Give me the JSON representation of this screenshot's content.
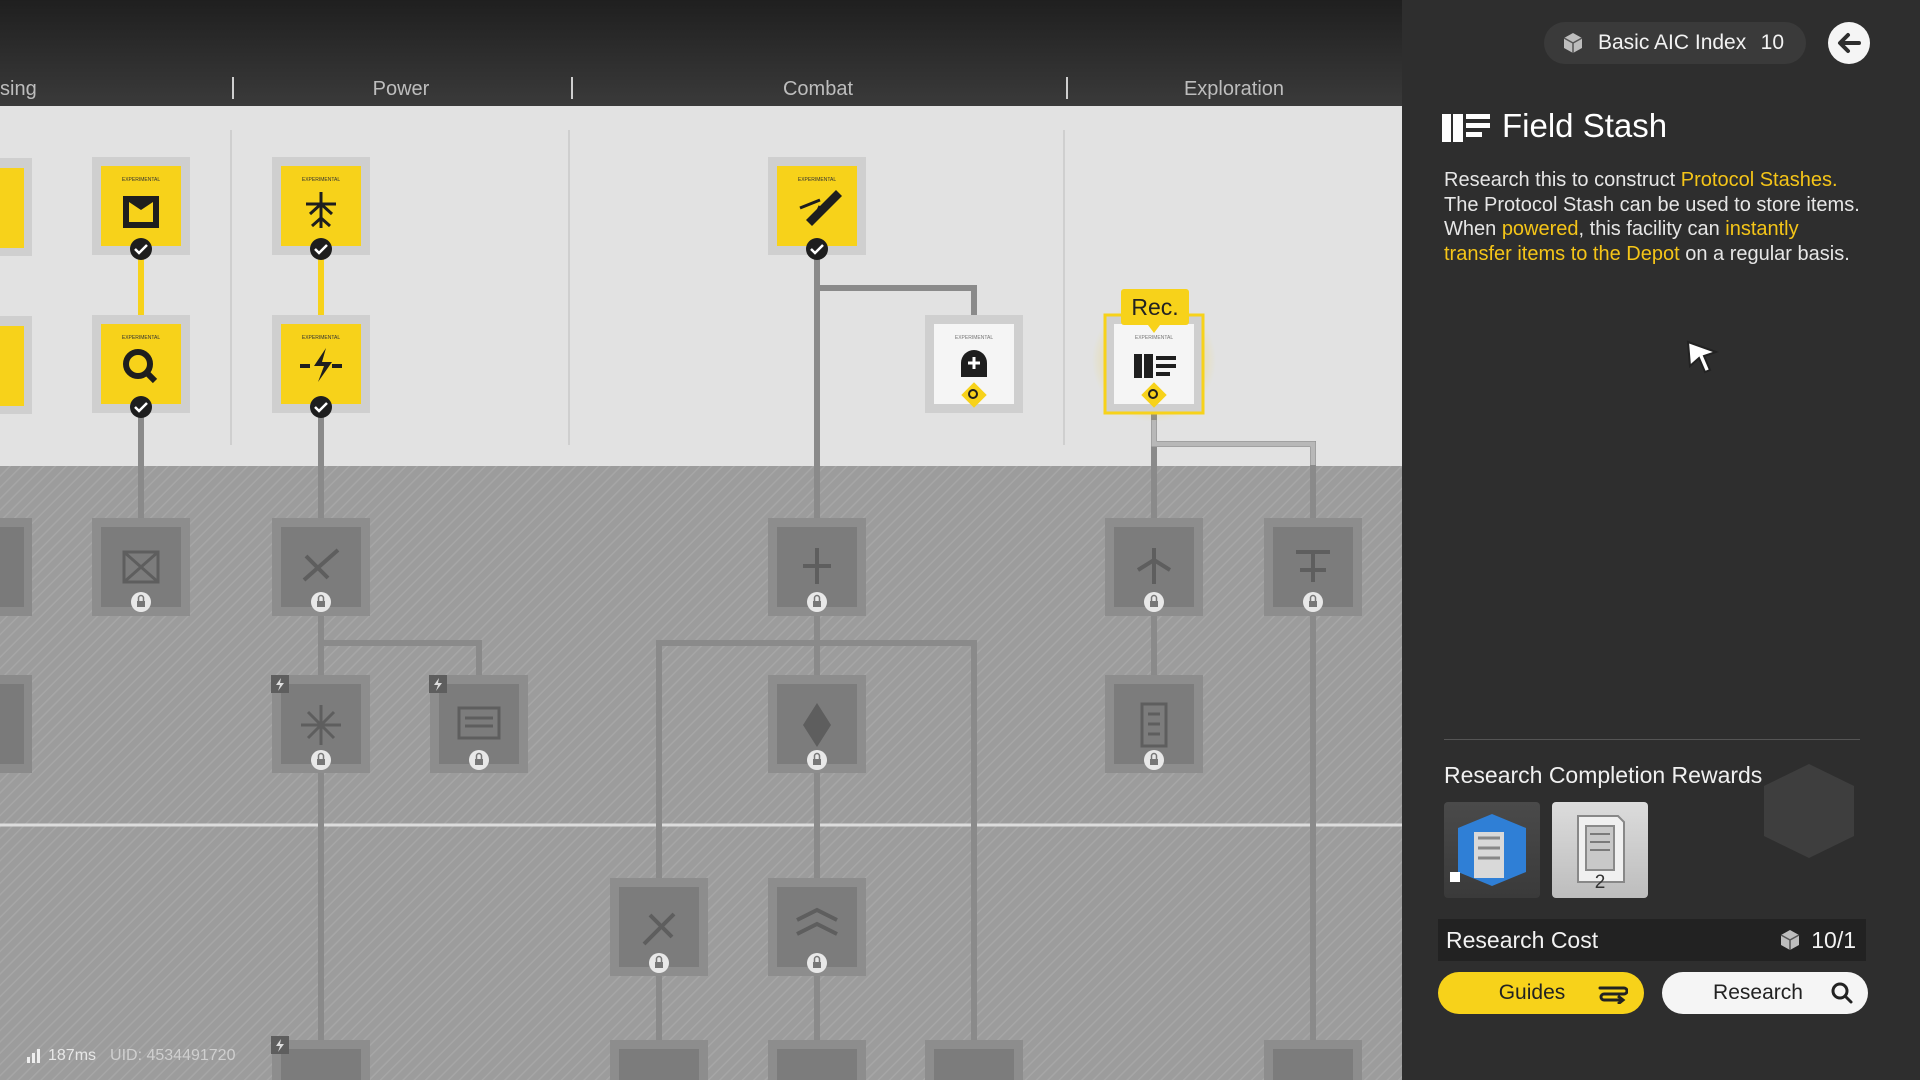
{
  "categories": [
    "sing",
    "Power",
    "Combat",
    "Exploration"
  ],
  "aic_index": {
    "icon": "cube-icon",
    "label": "Basic AIC Index",
    "value": "10"
  },
  "back_icon": "back-arrow-icon",
  "tree": {
    "rec_label": "Rec.",
    "node_header": "EXPERIMENTAL"
  },
  "detail": {
    "icon": "field-stash-icon",
    "title": "Field Stash",
    "desc_1": "Research this to construct ",
    "desc_hl_1": "Protocol Stashes.",
    "desc_2": "The Protocol Stash can be used to store items. When ",
    "desc_hl_2": "powered",
    "desc_3": ", this facility can ",
    "desc_hl_3": "instantly transfer items to the Depot",
    "desc_4": " on a regular basis."
  },
  "rewards": {
    "title": "Research Completion Rewards",
    "items": [
      {
        "name": "protocol-stash-blueprint",
        "count": ""
      },
      {
        "name": "protocol-stash",
        "count": "2"
      }
    ]
  },
  "cost": {
    "label": "Research Cost",
    "icon": "cube-icon",
    "value": "10/1"
  },
  "buttons": {
    "guides": "Guides",
    "research": "Research"
  },
  "status": {
    "ping": "187ms",
    "uid": "UID: 4534491720"
  },
  "colors": {
    "accent": "#f7d21a",
    "highlight": "#f5c518",
    "panel": "#2e2e2e"
  }
}
